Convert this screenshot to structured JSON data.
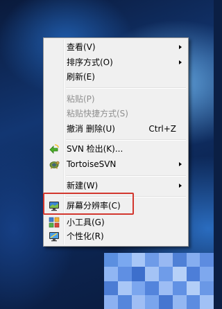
{
  "context_menu": {
    "view": "查看(V)",
    "sort": "排序方式(O)",
    "refresh": "刷新(E)",
    "paste": "粘贴(P)",
    "paste_shortcut": "粘贴快捷方式(S)",
    "undo_delete": "撤消 删除(U)",
    "undo_shortcut": "Ctrl+Z",
    "svn_checkout": "SVN 检出(K)...",
    "tortoise_svn": "TortoiseSVN",
    "new": "新建(W)",
    "screen_resolution": "屏幕分辨率(C)",
    "gadgets": "小工具(G)",
    "personalize": "个性化(R)"
  },
  "icons": {
    "svn_checkout": "svn-checkout-icon",
    "tortoise_svn": "tortoise-svn-icon",
    "screen_resolution": "monitor-icon",
    "gadgets": "gadgets-icon",
    "personalize": "personalize-icon"
  },
  "colors": {
    "highlight_box": "#d2362d",
    "menu_background": "#f0f0f0"
  }
}
